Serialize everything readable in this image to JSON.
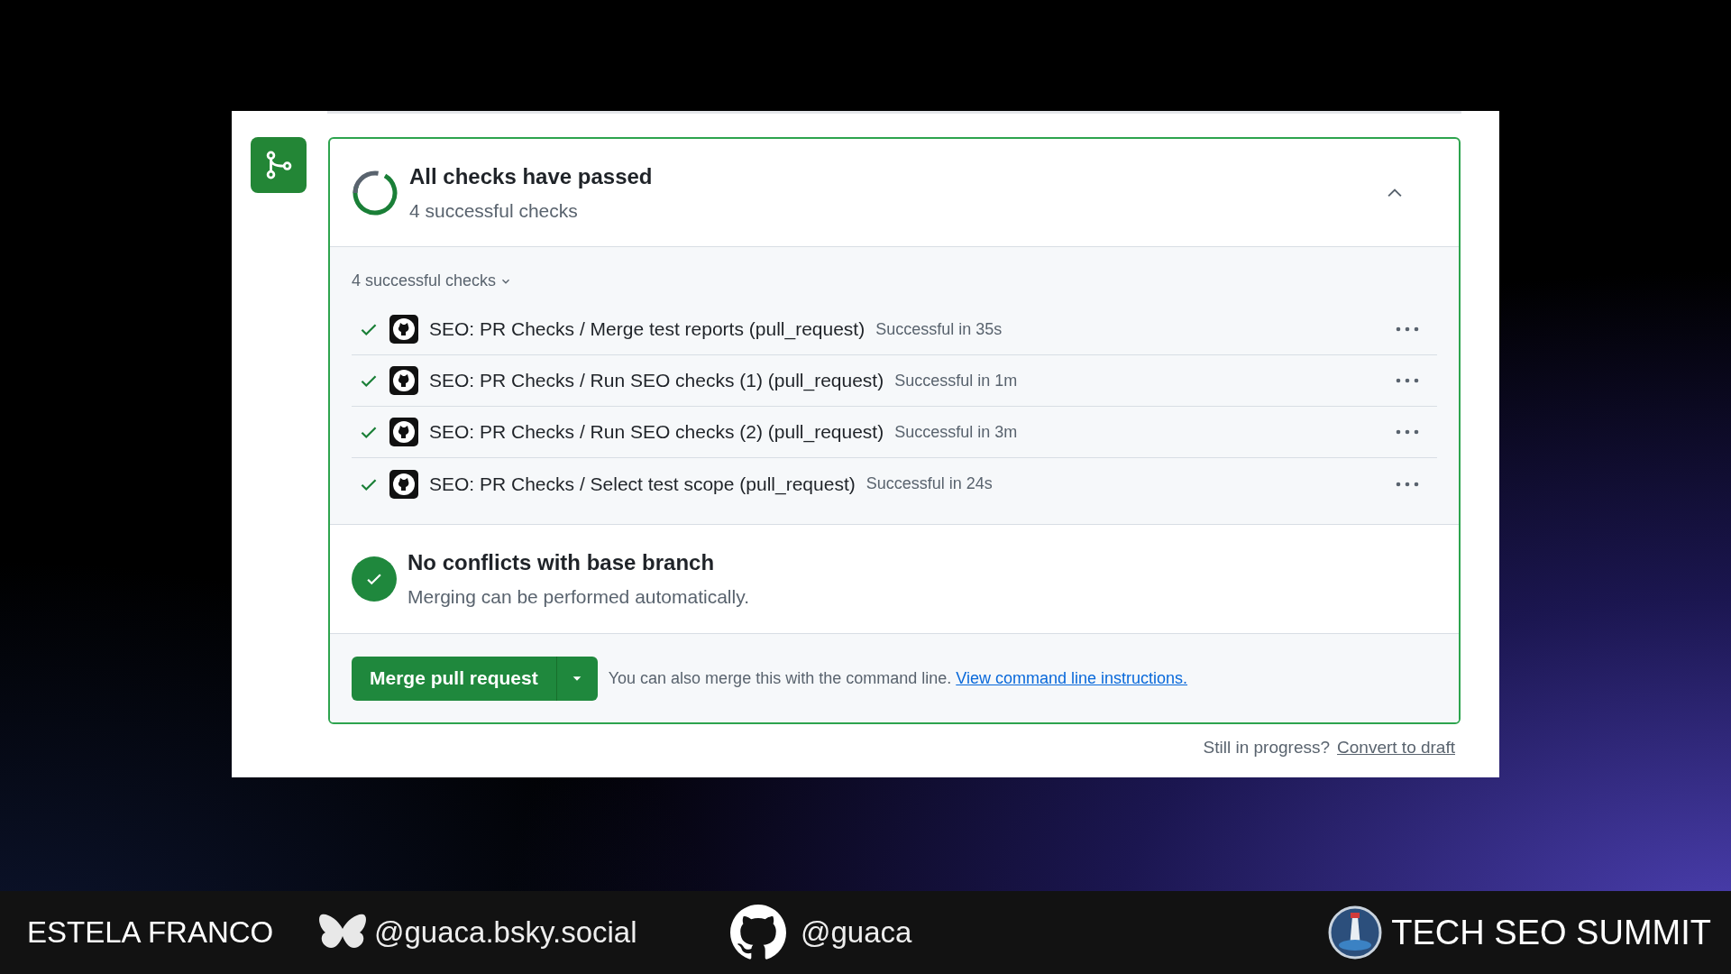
{
  "checks_panel": {
    "title": "All checks have passed",
    "subtitle": "4 successful checks",
    "expanded": true,
    "summary_toggle": "4 successful checks",
    "checks": [
      {
        "name": "SEO: PR Checks / Merge test reports (pull_request)",
        "result": "Successful in 35s"
      },
      {
        "name": "SEO: PR Checks / Run SEO checks (1) (pull_request)",
        "result": "Successful in 1m"
      },
      {
        "name": "SEO: PR Checks / Run SEO checks (2) (pull_request)",
        "result": "Successful in 3m"
      },
      {
        "name": "SEO: PR Checks / Select test scope (pull_request)",
        "result": "Successful in 24s"
      }
    ]
  },
  "conflicts": {
    "title": "No conflicts with base branch",
    "subtitle": "Merging can be performed automatically."
  },
  "merge": {
    "button": "Merge pull request",
    "note": "You can also merge this with the command line.",
    "link": "View command line instructions."
  },
  "draft": {
    "question": "Still in progress?",
    "link": "Convert to draft"
  },
  "lower_third": {
    "speaker": "ESTELA FRANCO",
    "bluesky": "@guaca.bsky.social",
    "github": "@guaca",
    "event": "TECH SEO SUMMIT"
  }
}
